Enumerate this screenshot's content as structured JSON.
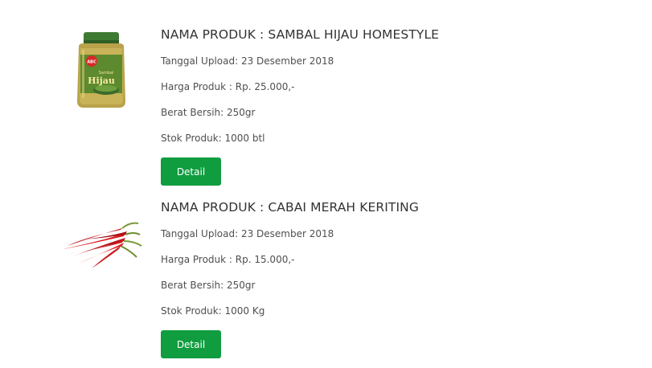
{
  "products": [
    {
      "image": "sambal-hijau-jar-image",
      "title": "NAMA PRODUK : SAMBAL HIJAU HOMESTYLE",
      "upload": "Tanggal Upload: 23 Desember 2018",
      "price": "Harga Produk : Rp. 25.000,-",
      "weight": "Berat Bersih: 250gr",
      "stock": "Stok Produk: 1000 btl",
      "jar_brand": "ABC",
      "jar_label_small": "Sambal",
      "jar_label_big": "Hijau",
      "button_label": "Detail"
    },
    {
      "image": "red-chili-image",
      "title": "NAMA PRODUK : CABAI MERAH KERITING",
      "upload": "Tanggal Upload: 23 Desember 2018",
      "price": "Harga Produk : Rp. 15.000,-",
      "weight": "Berat Bersih: 250gr",
      "stock": "Stok Produk: 1000 Kg",
      "button_label": "Detail"
    }
  ],
  "colors": {
    "button_green": "#0f9d3f",
    "text": "#4f4f4f",
    "title": "#333333"
  }
}
